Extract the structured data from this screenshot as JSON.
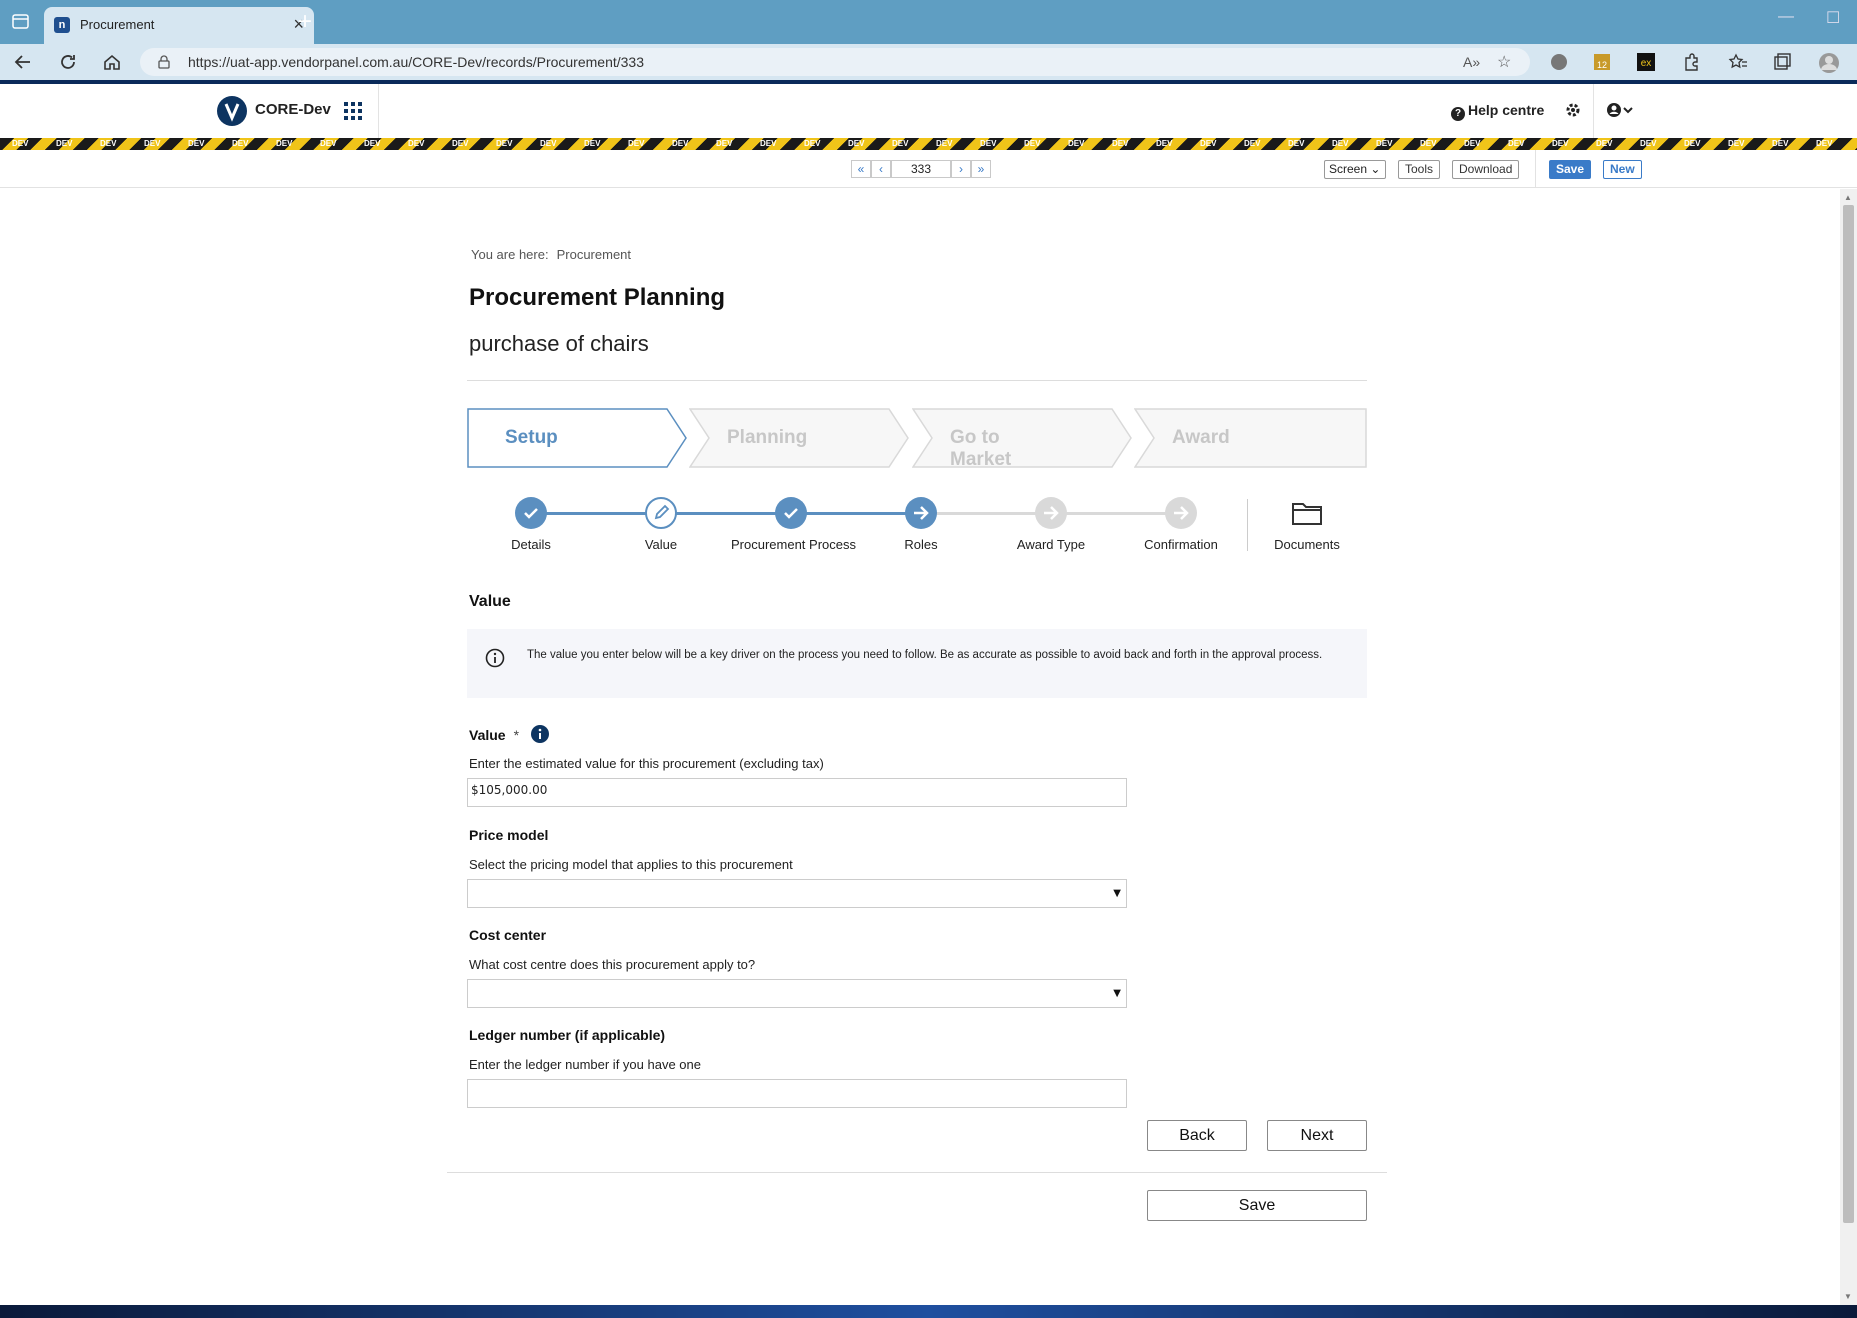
{
  "browser": {
    "tab_title": "Procurement",
    "url": "https://uat-app.vendorpanel.com.au/CORE-Dev/records/Procurement/333"
  },
  "header": {
    "brand": "CORE-Dev",
    "help_label": "Help centre",
    "stripe_label": "DEV"
  },
  "record_toolbar": {
    "record_number": "333",
    "view_select": "Screen",
    "tools_label": "Tools",
    "download_label": "Download",
    "save_label": "Save",
    "new_label": "New"
  },
  "breadcrumb": {
    "prefix": "You are here:",
    "current": "Procurement"
  },
  "page": {
    "title": "Procurement Planning",
    "subtitle": "purchase of chairs"
  },
  "stages": [
    {
      "label": "Setup",
      "active": true
    },
    {
      "label": "Planning",
      "active": false
    },
    {
      "label": "Go to Market",
      "active": false
    },
    {
      "label": "Award",
      "active": false
    }
  ],
  "steps": [
    {
      "label": "Details",
      "state": "done"
    },
    {
      "label": "Value",
      "state": "current"
    },
    {
      "label": "Procurement Process",
      "state": "done"
    },
    {
      "label": "Roles",
      "state": "next"
    },
    {
      "label": "Award Type",
      "state": "pending"
    },
    {
      "label": "Confirmation",
      "state": "pending"
    },
    {
      "label": "Documents",
      "state": "folder"
    }
  ],
  "section": {
    "title": "Value",
    "info": "The value you enter below will be a key driver on the process you need to follow. Be as accurate as possible to avoid back and forth in the approval process."
  },
  "fields": {
    "value": {
      "label": "Value",
      "required": "*",
      "help": "Enter the estimated value for this procurement (excluding tax)",
      "value": "$105,000.00"
    },
    "price_model": {
      "label": "Price model",
      "help": "Select the pricing model that applies to this procurement",
      "value": ""
    },
    "cost_center": {
      "label": "Cost center",
      "help": "What cost centre does this procurement apply to?",
      "value": ""
    },
    "ledger": {
      "label": "Ledger number (if applicable)",
      "help": "Enter the ledger number if you have one",
      "value": ""
    }
  },
  "buttons": {
    "back": "Back",
    "next": "Next",
    "save": "Save"
  },
  "colors": {
    "accent": "#3a7bc8",
    "step_done": "#5b8fc0",
    "step_pending": "#d9d9d9",
    "brand_dark": "#0d3461"
  }
}
